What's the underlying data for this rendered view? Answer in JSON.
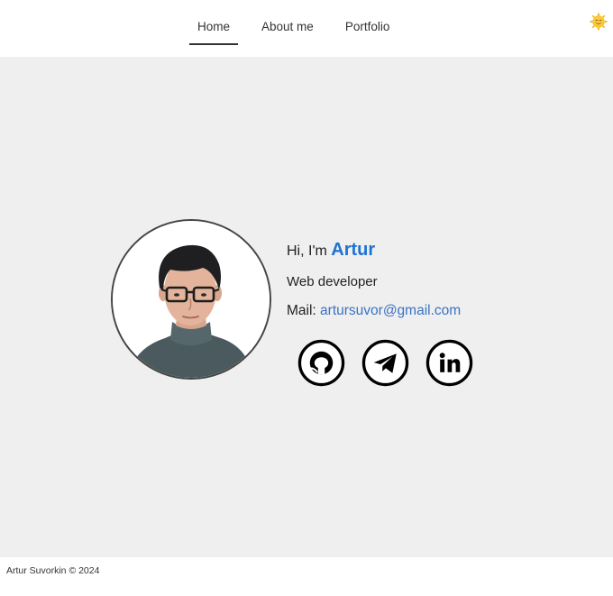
{
  "nav": {
    "items": [
      {
        "label": "Home",
        "active": true
      },
      {
        "label": "About me",
        "active": false
      },
      {
        "label": "Portfolio",
        "active": false
      }
    ]
  },
  "theme_toggle": {
    "icon": "sun-smiley-icon",
    "color": "#f2b418"
  },
  "profile": {
    "greeting_prefix": "Hi, I'm",
    "name": "Artur",
    "role": "Web developer",
    "mail_label": "Mail:",
    "email": "artursuvor@gmail.com",
    "photo_icon": "profile-photo"
  },
  "socials": [
    {
      "icon": "github-icon"
    },
    {
      "icon": "telegram-icon"
    },
    {
      "icon": "linkedin-icon"
    }
  ],
  "footer": {
    "text": "Artur Suvorkin © 2024"
  },
  "colors": {
    "accent": "#1e73d1",
    "link": "#3a72c4",
    "background": "#efefef"
  }
}
